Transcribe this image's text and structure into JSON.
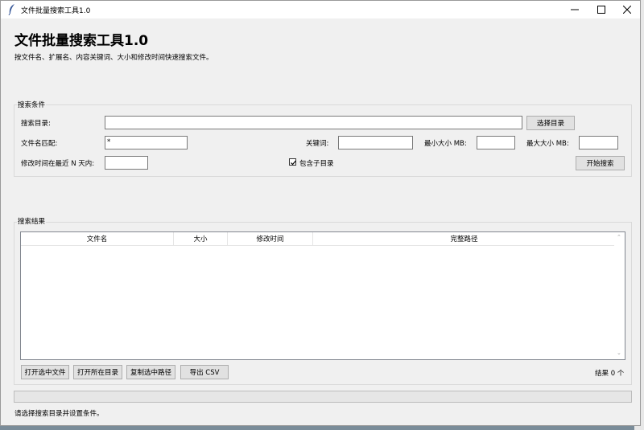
{
  "window": {
    "title": "文件批量搜索工具1.0"
  },
  "header": {
    "title": "文件批量搜索工具1.0",
    "subtitle": "按文件名、扩展名、内容关键词、大小和修改时间快速搜索文件。"
  },
  "search": {
    "group_label": "搜索条件",
    "dir_label": "搜索目录:",
    "dir_value": "",
    "choose_dir_label": "选择目录",
    "name_label": "文件名匹配:",
    "name_value": "*",
    "keyword_label": "关键词:",
    "keyword_value": "",
    "min_size_label": "最小大小 MB:",
    "min_size_value": "",
    "max_size_label": "最大大小 MB:",
    "max_size_value": "",
    "days_label": "修改时间在最近 N 天内:",
    "days_value": "",
    "subdirs_label": "包含子目录",
    "subdirs_checked": true,
    "start_label": "开始搜索"
  },
  "results": {
    "group_label": "搜索结果",
    "columns": [
      "文件名",
      "大小",
      "修改时间",
      "完整路径"
    ],
    "rows": [],
    "open_file_label": "打开选中文件",
    "open_dir_label": "打开所在目录",
    "copy_path_label": "复制选中路径",
    "export_label": "导出 CSV",
    "count_text": "结果 0 个"
  },
  "progress": 0,
  "status": {
    "text": "请选择搜索目录并设置条件。"
  }
}
